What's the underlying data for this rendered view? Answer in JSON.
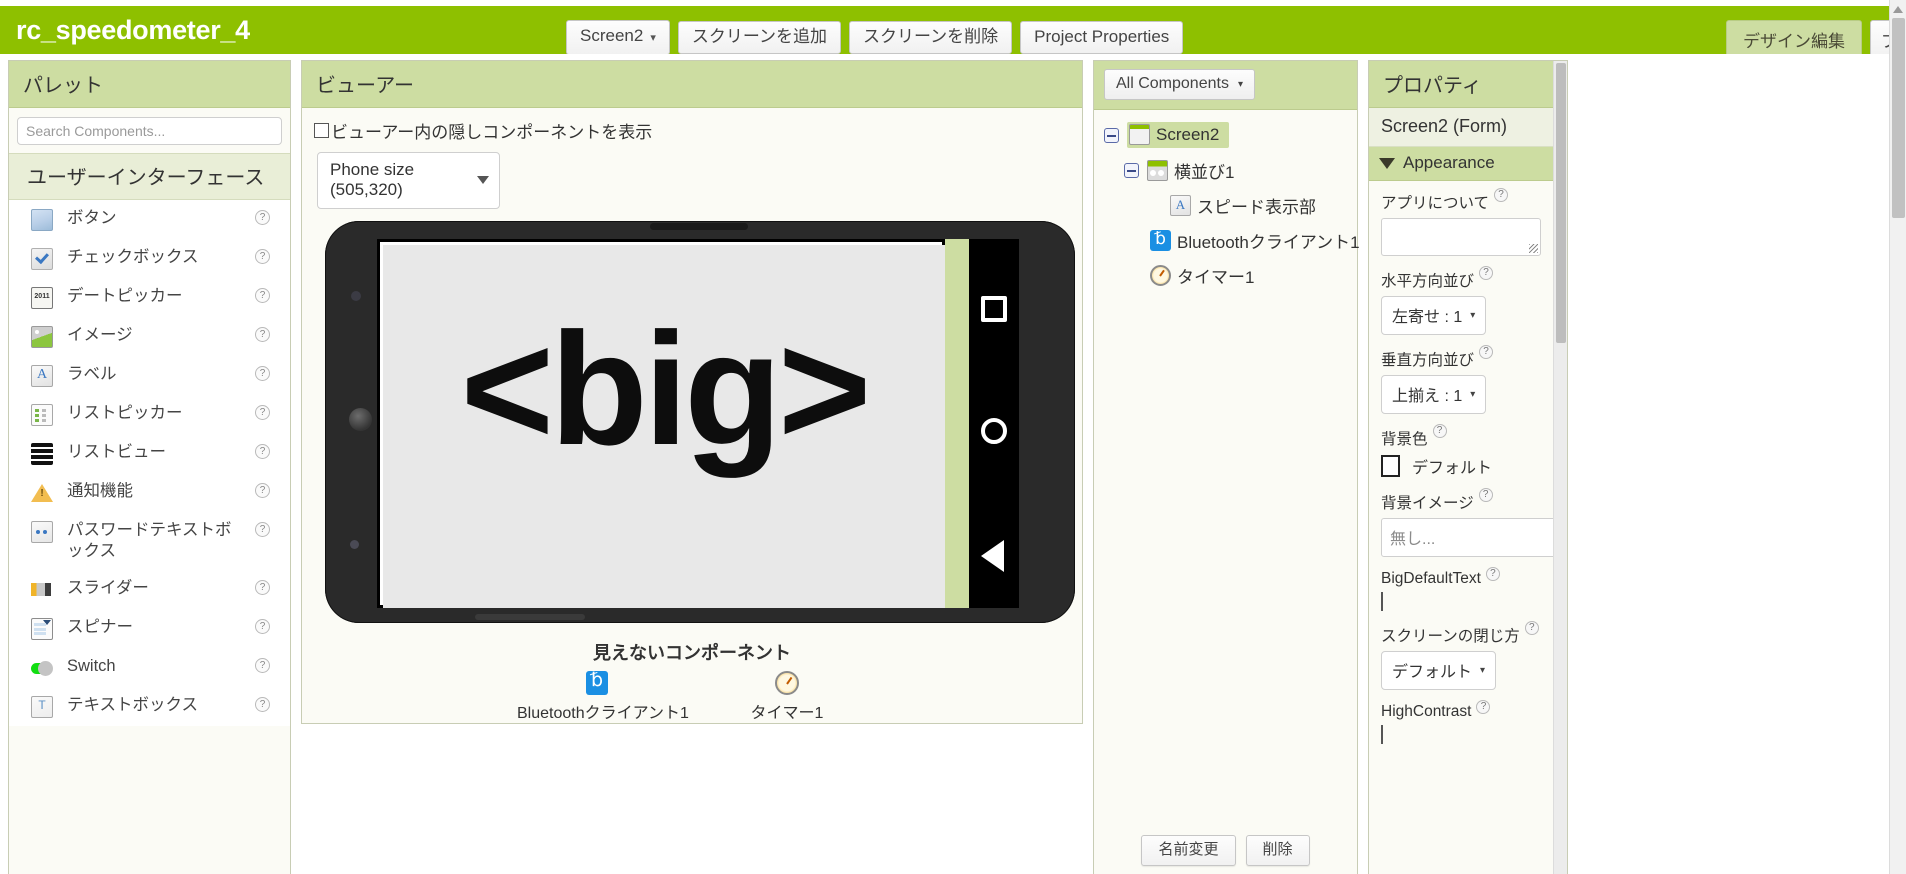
{
  "topbar": {
    "project_title": "rc_speedometer_4",
    "screen_selector": "Screen2",
    "add_screen": "スクリーンを追加",
    "remove_screen": "スクリーンを削除",
    "project_properties": "Project Properties",
    "tab_designer": "デザイン編集",
    "tab_blocks": "ブ",
    "accent_green": "#8ec000",
    "caret": "▾"
  },
  "palette": {
    "header": "パレット",
    "search_placeholder": "Search Components...",
    "category": "ユーザーインターフェース",
    "help_glyph": "?",
    "items": [
      {
        "label": "ボタン",
        "icon": "button-icon",
        "icon_class": "ic-button"
      },
      {
        "label": "チェックボックス",
        "icon": "checkbox-icon",
        "icon_class": "ic-checkbox"
      },
      {
        "label": "デートピッカー",
        "icon": "datepicker-icon",
        "icon_class": "ic-datepicker"
      },
      {
        "label": "イメージ",
        "icon": "image-icon",
        "icon_class": "ic-image"
      },
      {
        "label": "ラベル",
        "icon": "label-icon",
        "icon_class": "ic-label"
      },
      {
        "label": "リストピッカー",
        "icon": "listpicker-icon",
        "icon_class": "ic-listpicker"
      },
      {
        "label": "リストビュー",
        "icon": "listview-icon",
        "icon_class": "ic-listview"
      },
      {
        "label": "通知機能",
        "icon": "notifier-icon",
        "icon_class": "ic-notifier"
      },
      {
        "label": "パスワードテキストボックス",
        "icon": "password-textbox-icon",
        "icon_class": "ic-password"
      },
      {
        "label": "スライダー",
        "icon": "slider-icon",
        "icon_class": "ic-slider"
      },
      {
        "label": "スピナー",
        "icon": "spinner-icon",
        "icon_class": "ic-spinner"
      },
      {
        "label": "Switch",
        "icon": "switch-icon",
        "icon_class": "ic-switch"
      },
      {
        "label": "テキストボックス",
        "icon": "textbox-icon",
        "icon_class": "ic-textbox"
      }
    ]
  },
  "viewer": {
    "header": "ビューアー",
    "show_hidden_label": "ビューアー内の隠しコンポーネントを表示",
    "show_hidden_checked": false,
    "phone_size": "Phone size (505,320)",
    "screen_text": "<big>",
    "hidden_title": "見えないコンポーネント",
    "hidden_components": [
      {
        "label": "Bluetoothクライアント1",
        "icon": "bluetooth-icon"
      },
      {
        "label": "タイマー1",
        "icon": "clock-icon"
      }
    ]
  },
  "tree": {
    "filter": "All Components",
    "caret": "▾",
    "nodes": [
      {
        "label": "Screen2",
        "icon": "screen-icon",
        "icon_class": "ic-screen",
        "depth": 0,
        "expandable": true,
        "selected": true
      },
      {
        "label": "横並び1",
        "icon": "horizontal-arrangement-icon",
        "icon_class": "ic-harr",
        "depth": 1,
        "expandable": true,
        "selected": false
      },
      {
        "label": "スピード表示部",
        "icon": "label-icon",
        "icon_class": "ic-lbl",
        "depth": 2,
        "expandable": false,
        "selected": false
      },
      {
        "label": "Bluetoothクライアント1",
        "icon": "bluetooth-icon",
        "icon_class": "ic-bt",
        "depth": 1,
        "expandable": false,
        "selected": false
      },
      {
        "label": "タイマー1",
        "icon": "clock-icon",
        "icon_class": "ic-clock",
        "depth": 1,
        "expandable": false,
        "selected": false
      }
    ],
    "rename_button": "名前変更",
    "delete_button": "削除"
  },
  "properties": {
    "header": "プロパティ",
    "component": "Screen2 (Form)",
    "section": "Appearance",
    "help_glyph": "?",
    "fields": {
      "about_app": {
        "label": "アプリについて",
        "value": ""
      },
      "align_horizontal": {
        "label": "水平方向並び",
        "value": "左寄せ : 1"
      },
      "align_vertical": {
        "label": "垂直方向並び",
        "value": "上揃え : 1"
      },
      "background_color": {
        "label": "背景色",
        "value": "デフォルト",
        "swatch": "#ffffff"
      },
      "background_image": {
        "label": "背景イメージ",
        "value": "無し..."
      },
      "big_default_text": {
        "label": "BigDefaultText",
        "checked": false
      },
      "close_screen_animation": {
        "label": "スクリーンの閉じ方",
        "value": "デフォルト"
      },
      "high_contrast": {
        "label": "HighContrast",
        "checked": false
      }
    }
  }
}
